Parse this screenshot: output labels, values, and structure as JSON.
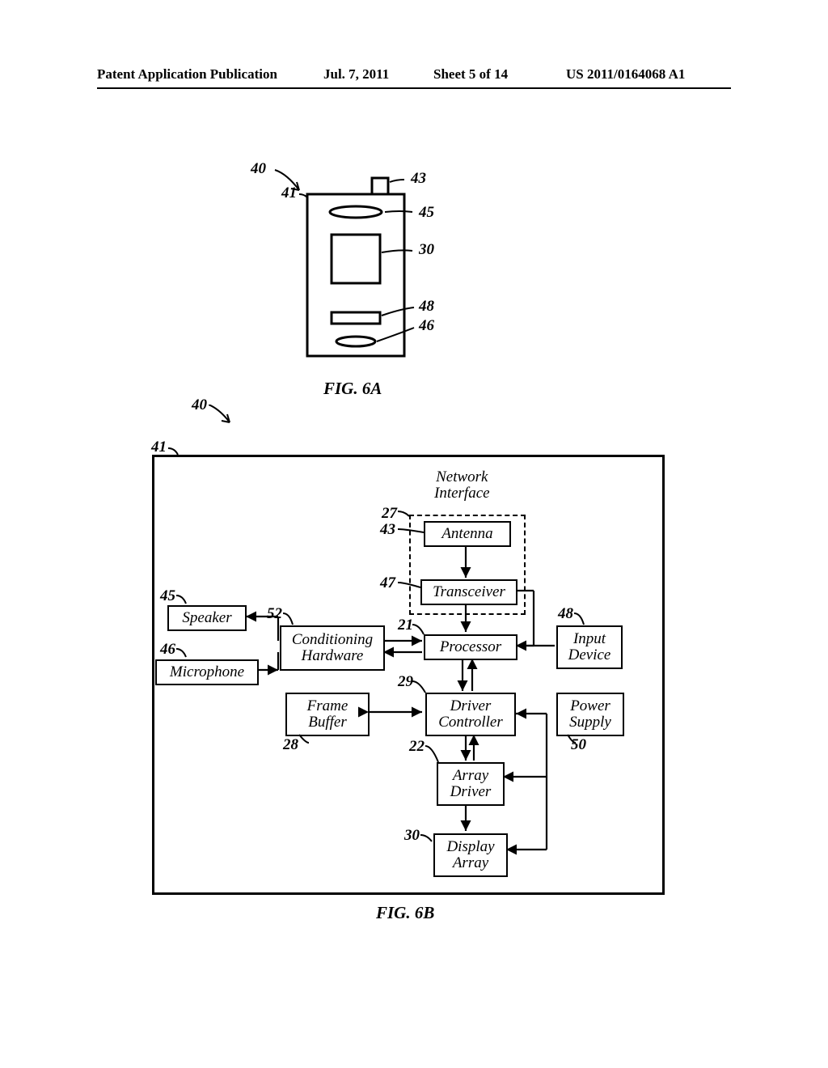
{
  "header": {
    "left": "Patent Application Publication",
    "date": "Jul. 7, 2011",
    "sheet": "Sheet 5 of 14",
    "pub": "US 2011/0164068 A1"
  },
  "fig6a": {
    "label": "FIG. 6A",
    "refs": {
      "r40": "40",
      "r41": "41",
      "r43": "43",
      "r45": "45",
      "r30": "30",
      "r48": "48",
      "r46": "46"
    }
  },
  "fig6b": {
    "label": "FIG. 6B",
    "refs": {
      "r40": "40",
      "r41": "41",
      "r45": "45",
      "r46": "46",
      "r52": "52",
      "r27": "27",
      "r43": "43",
      "r47": "47",
      "r21": "21",
      "r29": "29",
      "r48": "48",
      "r28": "28",
      "r22": "22",
      "r50": "50",
      "r30": "30"
    },
    "blocks": {
      "network_interface": "Network\nInterface",
      "antenna": "Antenna",
      "transceiver": "Transceiver",
      "speaker": "Speaker",
      "microphone": "Microphone",
      "conditioning": "Conditioning\nHardware",
      "processor": "Processor",
      "input_device": "Input\nDevice",
      "frame_buffer": "Frame\nBuffer",
      "driver_controller": "Driver\nController",
      "power_supply": "Power\nSupply",
      "array_driver": "Array\nDriver",
      "display_array": "Display\nArray"
    }
  }
}
